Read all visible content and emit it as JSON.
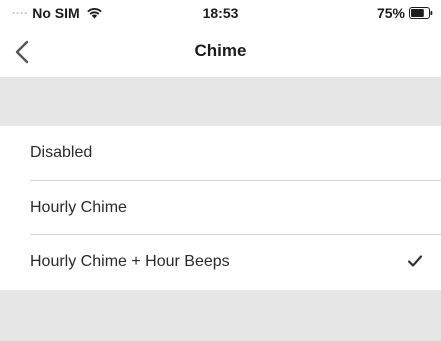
{
  "status_bar": {
    "signal": "....",
    "carrier": "No SIM",
    "wifi_icon": "wifi-icon",
    "time": "18:53",
    "battery_percent": "75%",
    "battery_level": 0.75
  },
  "nav": {
    "back_icon": "chevron-left-icon",
    "title": "Chime"
  },
  "options": {
    "items": [
      {
        "label": "Disabled",
        "selected": false
      },
      {
        "label": "Hourly Chime",
        "selected": false
      },
      {
        "label": "Hourly Chime + Hour Beeps",
        "selected": true
      }
    ]
  },
  "colors": {
    "section_background": "#e6e6e6",
    "separator": "#d4d4d4",
    "checkmark": "#333333"
  }
}
